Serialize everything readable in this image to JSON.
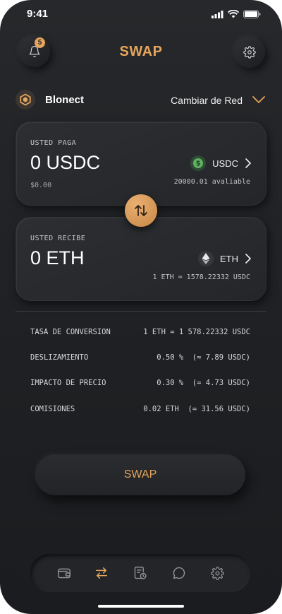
{
  "status_bar": {
    "time": "9:41"
  },
  "header": {
    "title": "SWAP",
    "notification_count": "5",
    "bell_icon": "bell-icon",
    "settings_icon": "gear-icon"
  },
  "network": {
    "name": "Blonect",
    "change_label": "Cambiar de Red"
  },
  "pay": {
    "label": "USTED PAGA",
    "amount": "0 USDC",
    "fiat": "$0.00",
    "token": "USDC",
    "balance": "20000.01 avaliable"
  },
  "receive": {
    "label": "USTED RECIBE",
    "amount": "0 ETH",
    "token": "ETH",
    "rate": "1 ETH ≈ 1578.22332 USDC"
  },
  "details": [
    {
      "label": "TASA DE CONVERSION",
      "value": "1 ETH ≈ 1 578.22332 USDC"
    },
    {
      "label": "DESLIZAMIENTO",
      "value": "0.50 %  (≈ 7.89 USDC)"
    },
    {
      "label": "IMPACTO DE PRECIO",
      "value": "0.30 %  (≈ 4.73 USDC)"
    },
    {
      "label": "COMISIONES",
      "value": "0.02 ETH  (≈ 31.56 USDC)"
    }
  ],
  "swap_button": {
    "label": "SWAP"
  },
  "tabs": [
    {
      "icon": "wallet-icon",
      "active": false
    },
    {
      "icon": "swap-arrows-icon",
      "active": true
    },
    {
      "icon": "history-icon",
      "active": false
    },
    {
      "icon": "chat-icon",
      "active": false
    },
    {
      "icon": "gear-icon",
      "active": false
    }
  ],
  "colors": {
    "accent": "#e6a55c",
    "background": "#1f2124",
    "usdc": "#5fb35f"
  }
}
